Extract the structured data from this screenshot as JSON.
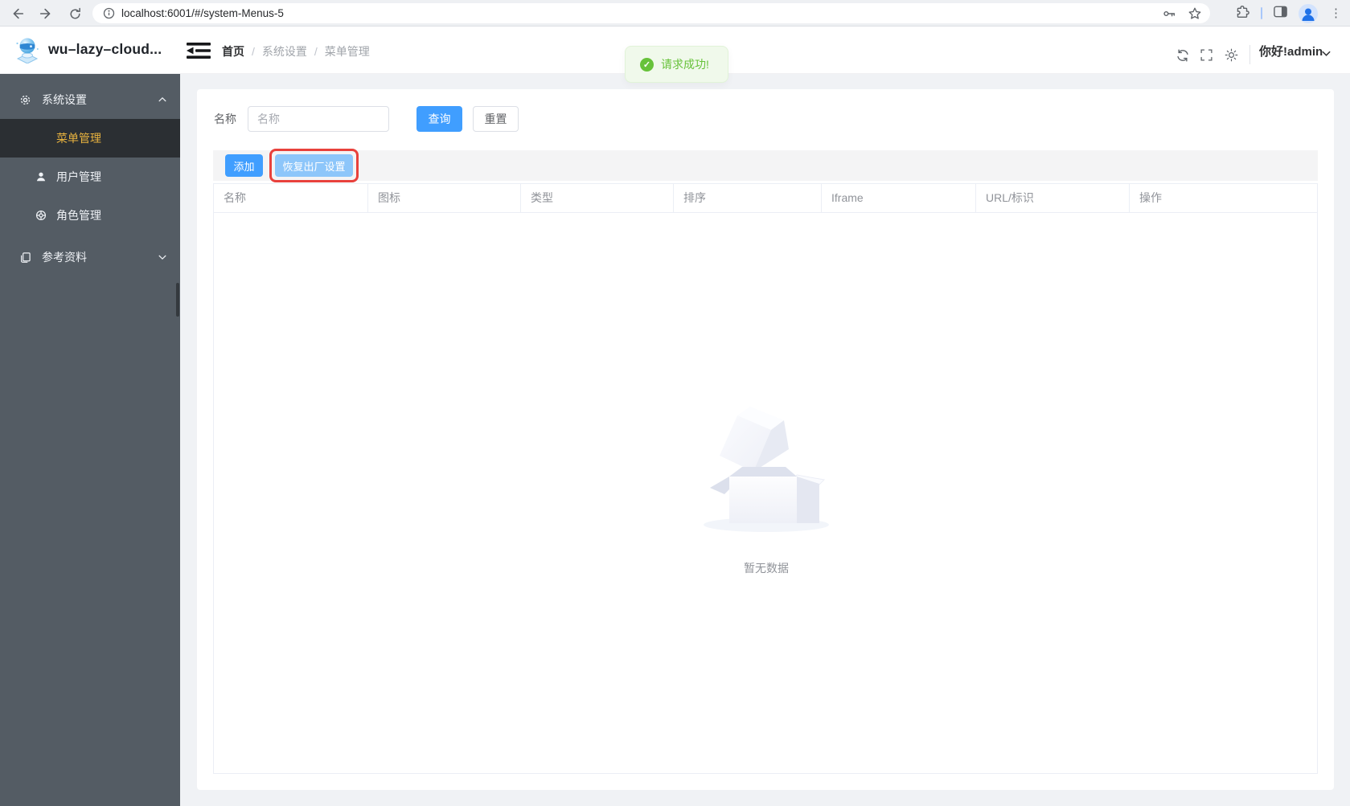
{
  "browser": {
    "url": "localhost:6001/#/system-Menus-5"
  },
  "app_header": {
    "title": "wu–lazy–cloud...",
    "breadcrumb": {
      "home": "首页",
      "section": "系统设置",
      "page": "菜单管理",
      "separator": "/"
    },
    "greeting": "你好!admin"
  },
  "toast": {
    "message": "请求成功!",
    "check": "✓"
  },
  "sidebar": {
    "system_settings": "系统设置",
    "menu_management": "菜单管理",
    "user_management": "用户管理",
    "role_management": "角色管理",
    "reference_materials": "参考资料"
  },
  "filters": {
    "name_label": "名称",
    "name_placeholder": "名称",
    "query": "查询",
    "reset": "重置"
  },
  "actions": {
    "add": "添加",
    "restore": "恢复出厂设置"
  },
  "table": {
    "columns": [
      "名称",
      "图标",
      "类型",
      "排序",
      "Iframe",
      "URL/标识",
      "操作"
    ],
    "empty_text": "暂无数据"
  },
  "kebab_glyph": "⋮",
  "colors": {
    "primary": "#409eff",
    "primary_light": "#8dc6fa",
    "success": "#67c23a",
    "sidebar_bg": "#545c64",
    "sidebar_active_bg": "#2b2f33",
    "sidebar_active_text": "#e7b23f",
    "annotation_red": "#e8413c"
  }
}
